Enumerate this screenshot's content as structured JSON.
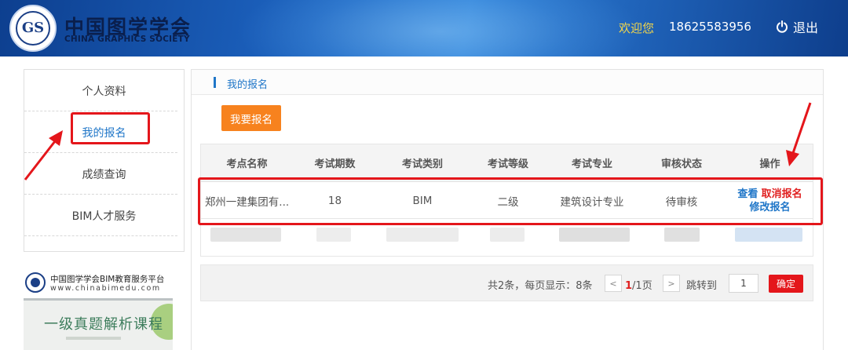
{
  "header": {
    "logo_cn": "中国图学学会",
    "logo_en": "CHINA GRAPHICS SOCIETY",
    "logo_mark": "GS",
    "welcome": "欢迎您",
    "phone": "18625583956",
    "logout_label": "退出"
  },
  "sidebar": {
    "items": [
      {
        "label": "个人资料"
      },
      {
        "label": "我的报名"
      },
      {
        "label": "成绩查询"
      },
      {
        "label": "BIM人才服务"
      }
    ],
    "active_index": 1
  },
  "promo": {
    "platform_name": "中国图学学会BIM教育服务平台",
    "url": "www.chinabimedu.com",
    "course_title": "一级真题解析课程"
  },
  "main": {
    "breadcrumb": "我的报名",
    "signup_button": "我要报名",
    "table": {
      "headers": [
        "考点名称",
        "考试期数",
        "考试类别",
        "考试等级",
        "考试专业",
        "审核状态",
        "操作"
      ],
      "rows": [
        {
          "site": "郑州一建集团有...",
          "period": "18",
          "category": "BIM",
          "level": "二级",
          "major": "建筑设计专业",
          "status": "待审核",
          "actions": {
            "view": "查看",
            "cancel": "取消报名",
            "edit": "修改报名"
          }
        }
      ]
    },
    "pagination": {
      "summary": "共2条，每页显示：8条",
      "prev": "<",
      "current": "1",
      "total_text": "/1页",
      "next": ">",
      "jump_label": "跳转到",
      "jump_value": "1",
      "confirm": "确定"
    }
  },
  "colors": {
    "accent_blue": "#1f76c8",
    "orange": "#f7821e",
    "red": "#e4161b",
    "welcome_yellow": "#f3d64a"
  }
}
